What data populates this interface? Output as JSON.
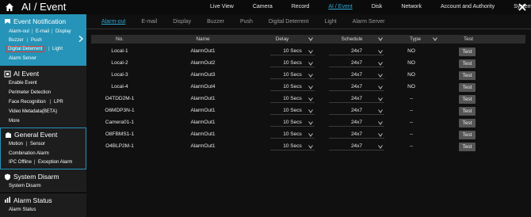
{
  "app": {
    "title": "AI / Event"
  },
  "topnav": [
    {
      "label": "Live View",
      "active": false
    },
    {
      "label": "Camera",
      "active": false
    },
    {
      "label": "Record",
      "active": false
    },
    {
      "label": "AI / Event",
      "active": true
    },
    {
      "label": "Disk",
      "active": false
    },
    {
      "label": "Network",
      "active": false
    },
    {
      "label": "Account and Authority",
      "active": false
    },
    {
      "label": "System",
      "active": false
    }
  ],
  "sidebar": {
    "event_notification": {
      "title": "Event Notification",
      "links": [
        "Alarm-out",
        "E-mail",
        "Display",
        "Buzzer",
        "Push",
        "Digital Deterrent",
        "Light",
        "Alarm Server"
      ],
      "selected": "Digital Deterrent"
    },
    "ai_event": {
      "title": "AI Event",
      "links": [
        "Enable Event",
        "Perimeter Detection",
        "Face Recognition",
        "LPR",
        "Video Metadata(BETA)",
        "More"
      ]
    },
    "general_event": {
      "title": "General Event",
      "links": [
        "Motion",
        "Sensor",
        "Combination Alarm",
        "IPC Offline",
        "Exception Alarm"
      ]
    },
    "system_disarm": {
      "title": "System Disarm",
      "links": [
        "System Disarm"
      ]
    },
    "alarm_status": {
      "title": "Alarm Status",
      "links": [
        "Alarm Status"
      ]
    }
  },
  "tabs": [
    {
      "label": "Alarm-out",
      "active": true
    },
    {
      "label": "E-mail",
      "active": false
    },
    {
      "label": "Display",
      "active": false
    },
    {
      "label": "Buzzer",
      "active": false
    },
    {
      "label": "Push",
      "active": false
    },
    {
      "label": "Digital Deterrent",
      "active": false
    },
    {
      "label": "Light",
      "active": false
    },
    {
      "label": "Alarm Server",
      "active": false
    }
  ],
  "table": {
    "columns": [
      "No.",
      "Name",
      "Delay",
      "Schedule",
      "Type",
      "Test"
    ],
    "rows": [
      {
        "no": "Local-1",
        "name": "AlarmOut1",
        "delay": "10 Secs",
        "schedule": "24x7",
        "type": "NO",
        "test": "Test"
      },
      {
        "no": "Local-2",
        "name": "AlarmOut2",
        "delay": "10 Secs",
        "schedule": "24x7",
        "type": "NO",
        "test": "Test"
      },
      {
        "no": "Local-3",
        "name": "AlarmOut3",
        "delay": "10 Secs",
        "schedule": "24x7",
        "type": "NO",
        "test": "Test"
      },
      {
        "no": "Local-4",
        "name": "AlarmOut4",
        "delay": "10 Secs",
        "schedule": "24x7",
        "type": "NO",
        "test": "Test"
      },
      {
        "no": "O4TDD2M-1",
        "name": "AlarmOut1",
        "delay": "10 Secs",
        "schedule": "24x7",
        "type": "--",
        "test": "Test"
      },
      {
        "no": "O6MDP3N-1",
        "name": "AlarmOut1",
        "delay": "10 Secs",
        "schedule": "24x7",
        "type": "--",
        "test": "Test"
      },
      {
        "no": "Camera01-1",
        "name": "AlarmOut1",
        "delay": "10 Secs",
        "schedule": "24x7",
        "type": "--",
        "test": "Test"
      },
      {
        "no": "O8FBMS1-1",
        "name": "AlarmOut1",
        "delay": "10 Secs",
        "schedule": "24x7",
        "type": "--",
        "test": "Test"
      },
      {
        "no": "O4BLP2M-1",
        "name": "AlarmOut1",
        "delay": "10 Secs",
        "schedule": "24x7",
        "type": "--",
        "test": "Test"
      }
    ]
  },
  "colors": {
    "accent": "#2594b8",
    "active_text": "#2aa8d6",
    "selected_outline": "#e03b2c"
  },
  "icons": {
    "home": "home-icon",
    "close": "close-icon",
    "event_notification": "bell-icon",
    "ai_event": "ai-chip-icon",
    "general_event": "general-event-icon",
    "system_disarm": "shield-icon",
    "alarm_status": "alarm-status-icon"
  }
}
